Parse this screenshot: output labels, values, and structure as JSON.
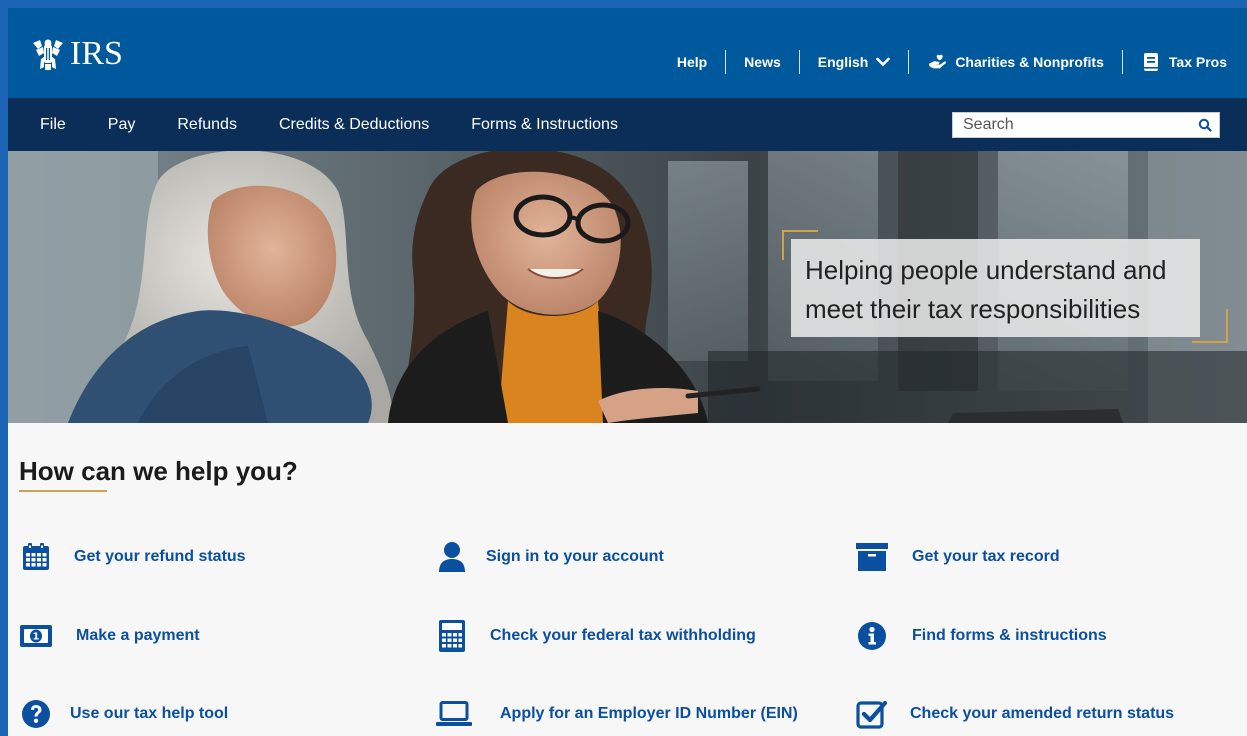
{
  "header": {
    "logo_text": "IRS",
    "utility": {
      "help": "Help",
      "news": "News",
      "language": "English",
      "charities": "Charities & Nonprofits",
      "tax_pros": "Tax Pros"
    }
  },
  "nav": {
    "items": [
      "File",
      "Pay",
      "Refunds",
      "Credits & Deductions",
      "Forms & Instructions"
    ],
    "search_placeholder": "Search"
  },
  "hero": {
    "tagline": "Helping people understand and meet their tax responsibilities"
  },
  "help": {
    "title": "How can we help you?",
    "tasks": [
      {
        "label": "Get your refund status",
        "icon": "calendar-icon"
      },
      {
        "label": "Sign in to your account",
        "icon": "person-icon"
      },
      {
        "label": "Get your tax record",
        "icon": "archive-box-icon"
      },
      {
        "label": "Make a payment",
        "icon": "money-bill-icon"
      },
      {
        "label": "Check your federal tax withholding",
        "icon": "calculator-icon"
      },
      {
        "label": "Find forms & instructions",
        "icon": "info-circle-icon"
      },
      {
        "label": "Use our tax help tool",
        "icon": "question-circle-icon"
      },
      {
        "label": "Apply for an Employer ID Number (EIN)",
        "icon": "laptop-icon"
      },
      {
        "label": "Check your amended return status",
        "icon": "checkbox-icon"
      }
    ]
  },
  "colors": {
    "header_blue": "#00599c",
    "nav_navy": "#0b2e59",
    "link_blue": "#0b4fa0",
    "accent_gold": "#d0a24c"
  }
}
